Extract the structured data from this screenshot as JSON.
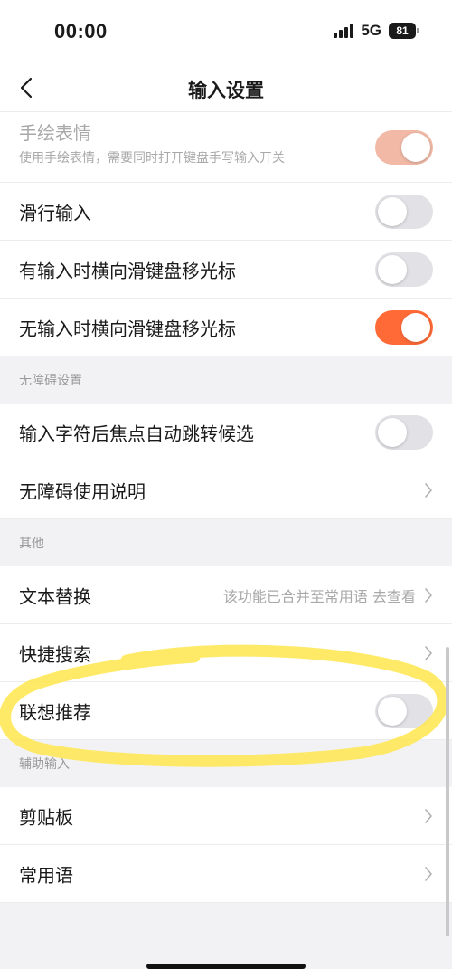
{
  "status": {
    "time": "00:00",
    "network": "5G",
    "battery": "81"
  },
  "nav": {
    "title": "输入设置"
  },
  "rows_top": [
    {
      "label": "手绘表情",
      "sub": "使用手绘表情，需要同时打开键盘手写输入开关",
      "toggle": "on-disabled"
    },
    {
      "label": "滑行输入",
      "toggle": "off"
    },
    {
      "label": "有输入时横向滑键盘移光标",
      "toggle": "off"
    },
    {
      "label": "无输入时横向滑键盘移光标",
      "toggle": "on"
    }
  ],
  "sections": [
    {
      "header": "无障碍设置",
      "rows": [
        {
          "label": "输入字符后焦点自动跳转候选",
          "toggle": "off"
        },
        {
          "label": "无障碍使用说明",
          "chevron": true
        }
      ]
    },
    {
      "header": "其他",
      "rows": [
        {
          "label": "文本替换",
          "value": "该功能已合并至常用语 去查看",
          "chevron": true
        },
        {
          "label": "快捷搜索",
          "chevron": true
        },
        {
          "label": "联想推荐",
          "toggle": "off"
        }
      ]
    },
    {
      "header": "辅助输入",
      "rows": [
        {
          "label": "剪贴板",
          "chevron": true
        },
        {
          "label": "常用语",
          "chevron": true
        }
      ]
    }
  ],
  "colors": {
    "accent": "#ff6a37",
    "accent_disabled": "#f1b9a6",
    "highlight": "#ffe64d"
  }
}
